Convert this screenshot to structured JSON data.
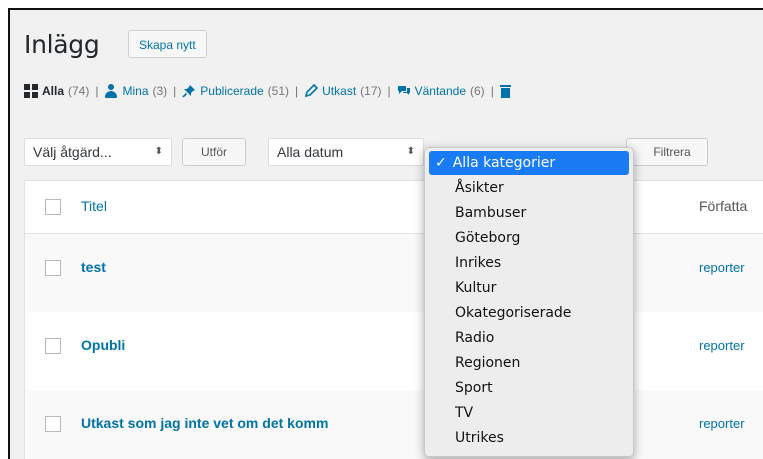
{
  "header": {
    "title": "Inlägg",
    "add_new": "Skapa nytt"
  },
  "views": [
    {
      "icon": "grid-icon",
      "label": "Alla",
      "count": "(74)",
      "current": true
    },
    {
      "icon": "user-icon",
      "label": "Mina",
      "count": "(3)"
    },
    {
      "icon": "pin-icon",
      "label": "Publicerade",
      "count": "(51)"
    },
    {
      "icon": "pencil-icon",
      "label": "Utkast",
      "count": "(17)"
    },
    {
      "icon": "comment-icon",
      "label": "Väntande",
      "count": "(6)"
    },
    {
      "icon": "trash-icon"
    }
  ],
  "separator": "|",
  "filters": {
    "bulk_action": "Välj åtgärd...",
    "apply": "Utför",
    "date": "Alla datum",
    "filter_button": "Filtrera"
  },
  "table": {
    "headers": {
      "title": "Titel",
      "author": "Författa"
    },
    "rows": [
      {
        "title": "test",
        "author": "reporter"
      },
      {
        "title": "Opubli",
        "author": "reporter"
      },
      {
        "title": "Utkast som jag inte vet om det komm",
        "author": "reporter"
      }
    ]
  },
  "category_dropdown": {
    "selected_mark": "✓",
    "options": [
      "Alla kategorier",
      "Åsikter",
      "Bambuser",
      "Göteborg",
      "Inrikes",
      "Kultur",
      "Okategoriserade",
      "Radio",
      "Regionen",
      "Sport",
      "TV",
      "Utrikes"
    ]
  },
  "colors": {
    "link": "#0073aa",
    "highlight": "#1a7cf5"
  }
}
